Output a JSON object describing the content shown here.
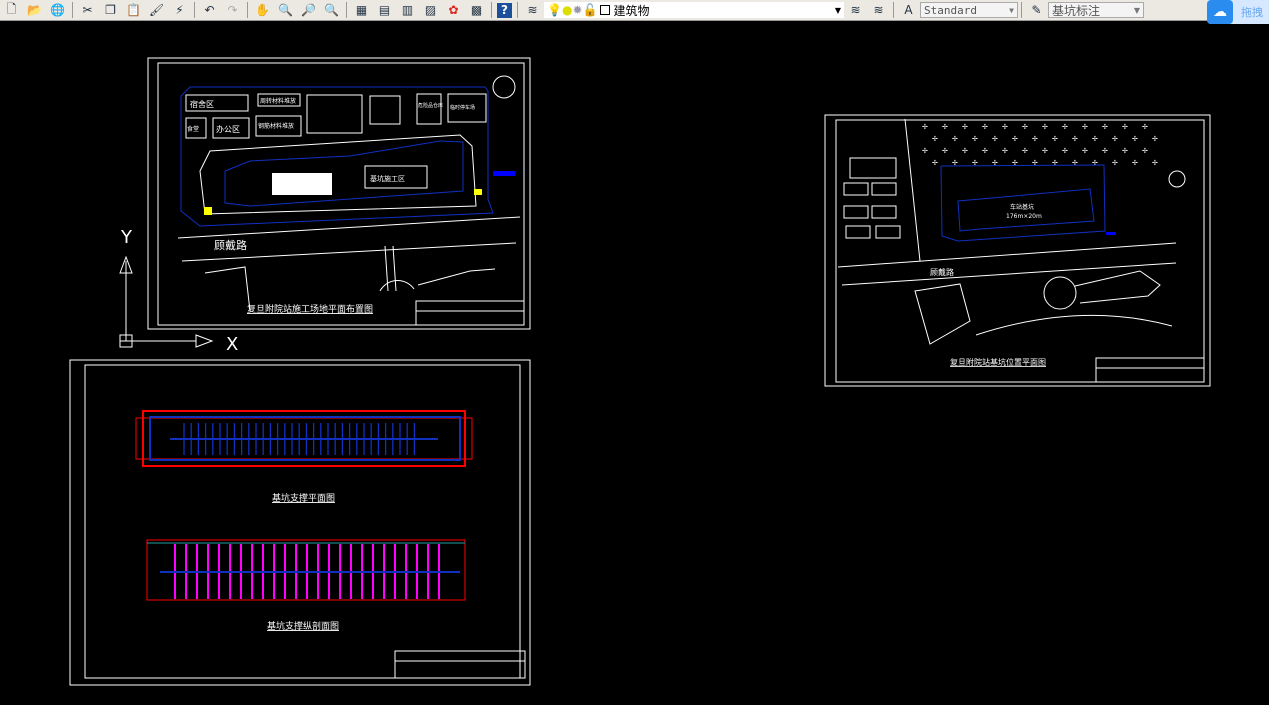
{
  "toolbar": {
    "icons": [
      "new-icon",
      "open-icon",
      "publish-icon",
      "cut-icon",
      "copy-icon",
      "paste-icon",
      "match-properties-icon",
      "block-editor-icon",
      "undo-icon",
      "redo-icon",
      "pan-icon",
      "zoom-realtime-icon",
      "zoom-window-icon",
      "zoom-previous-icon",
      "properties-icon",
      "design-center-icon",
      "tool-palettes-icon",
      "sheet-set-icon",
      "markup-icon",
      "calculator-icon",
      "help-icon",
      "layer-manager-icon"
    ],
    "layer_name": "建筑物",
    "text_style": "Standard",
    "dim_style": "基坑标注",
    "cloud_label": "拖拽"
  },
  "colors": {
    "canvas": "#000000",
    "blue": "#1030c0",
    "red": "#ff0000",
    "magenta": "#ff00ff",
    "white": "#ffffff",
    "yellow": "#ffff00"
  },
  "ucs": {
    "x_label": "X",
    "y_label": "Y"
  },
  "sheet1": {
    "title": "复旦附院站施工场地平面布置图",
    "road": "顾戴路",
    "zones": [
      "宿舍区",
      "办公区",
      "食堂",
      "钢筋材料堆放",
      "周转材料堆放",
      "危险品仓库",
      "临时停车场",
      "基坑施工区"
    ]
  },
  "sheet2": {
    "title1": "基坑支撑平面图",
    "title2": "基坑支撑纵剖面图"
  },
  "sheet3": {
    "title": "复旦附院站基坑位置平面图",
    "road": "顾戴路",
    "pit_label": "车站基坑",
    "pit_size": "176m×20m"
  }
}
